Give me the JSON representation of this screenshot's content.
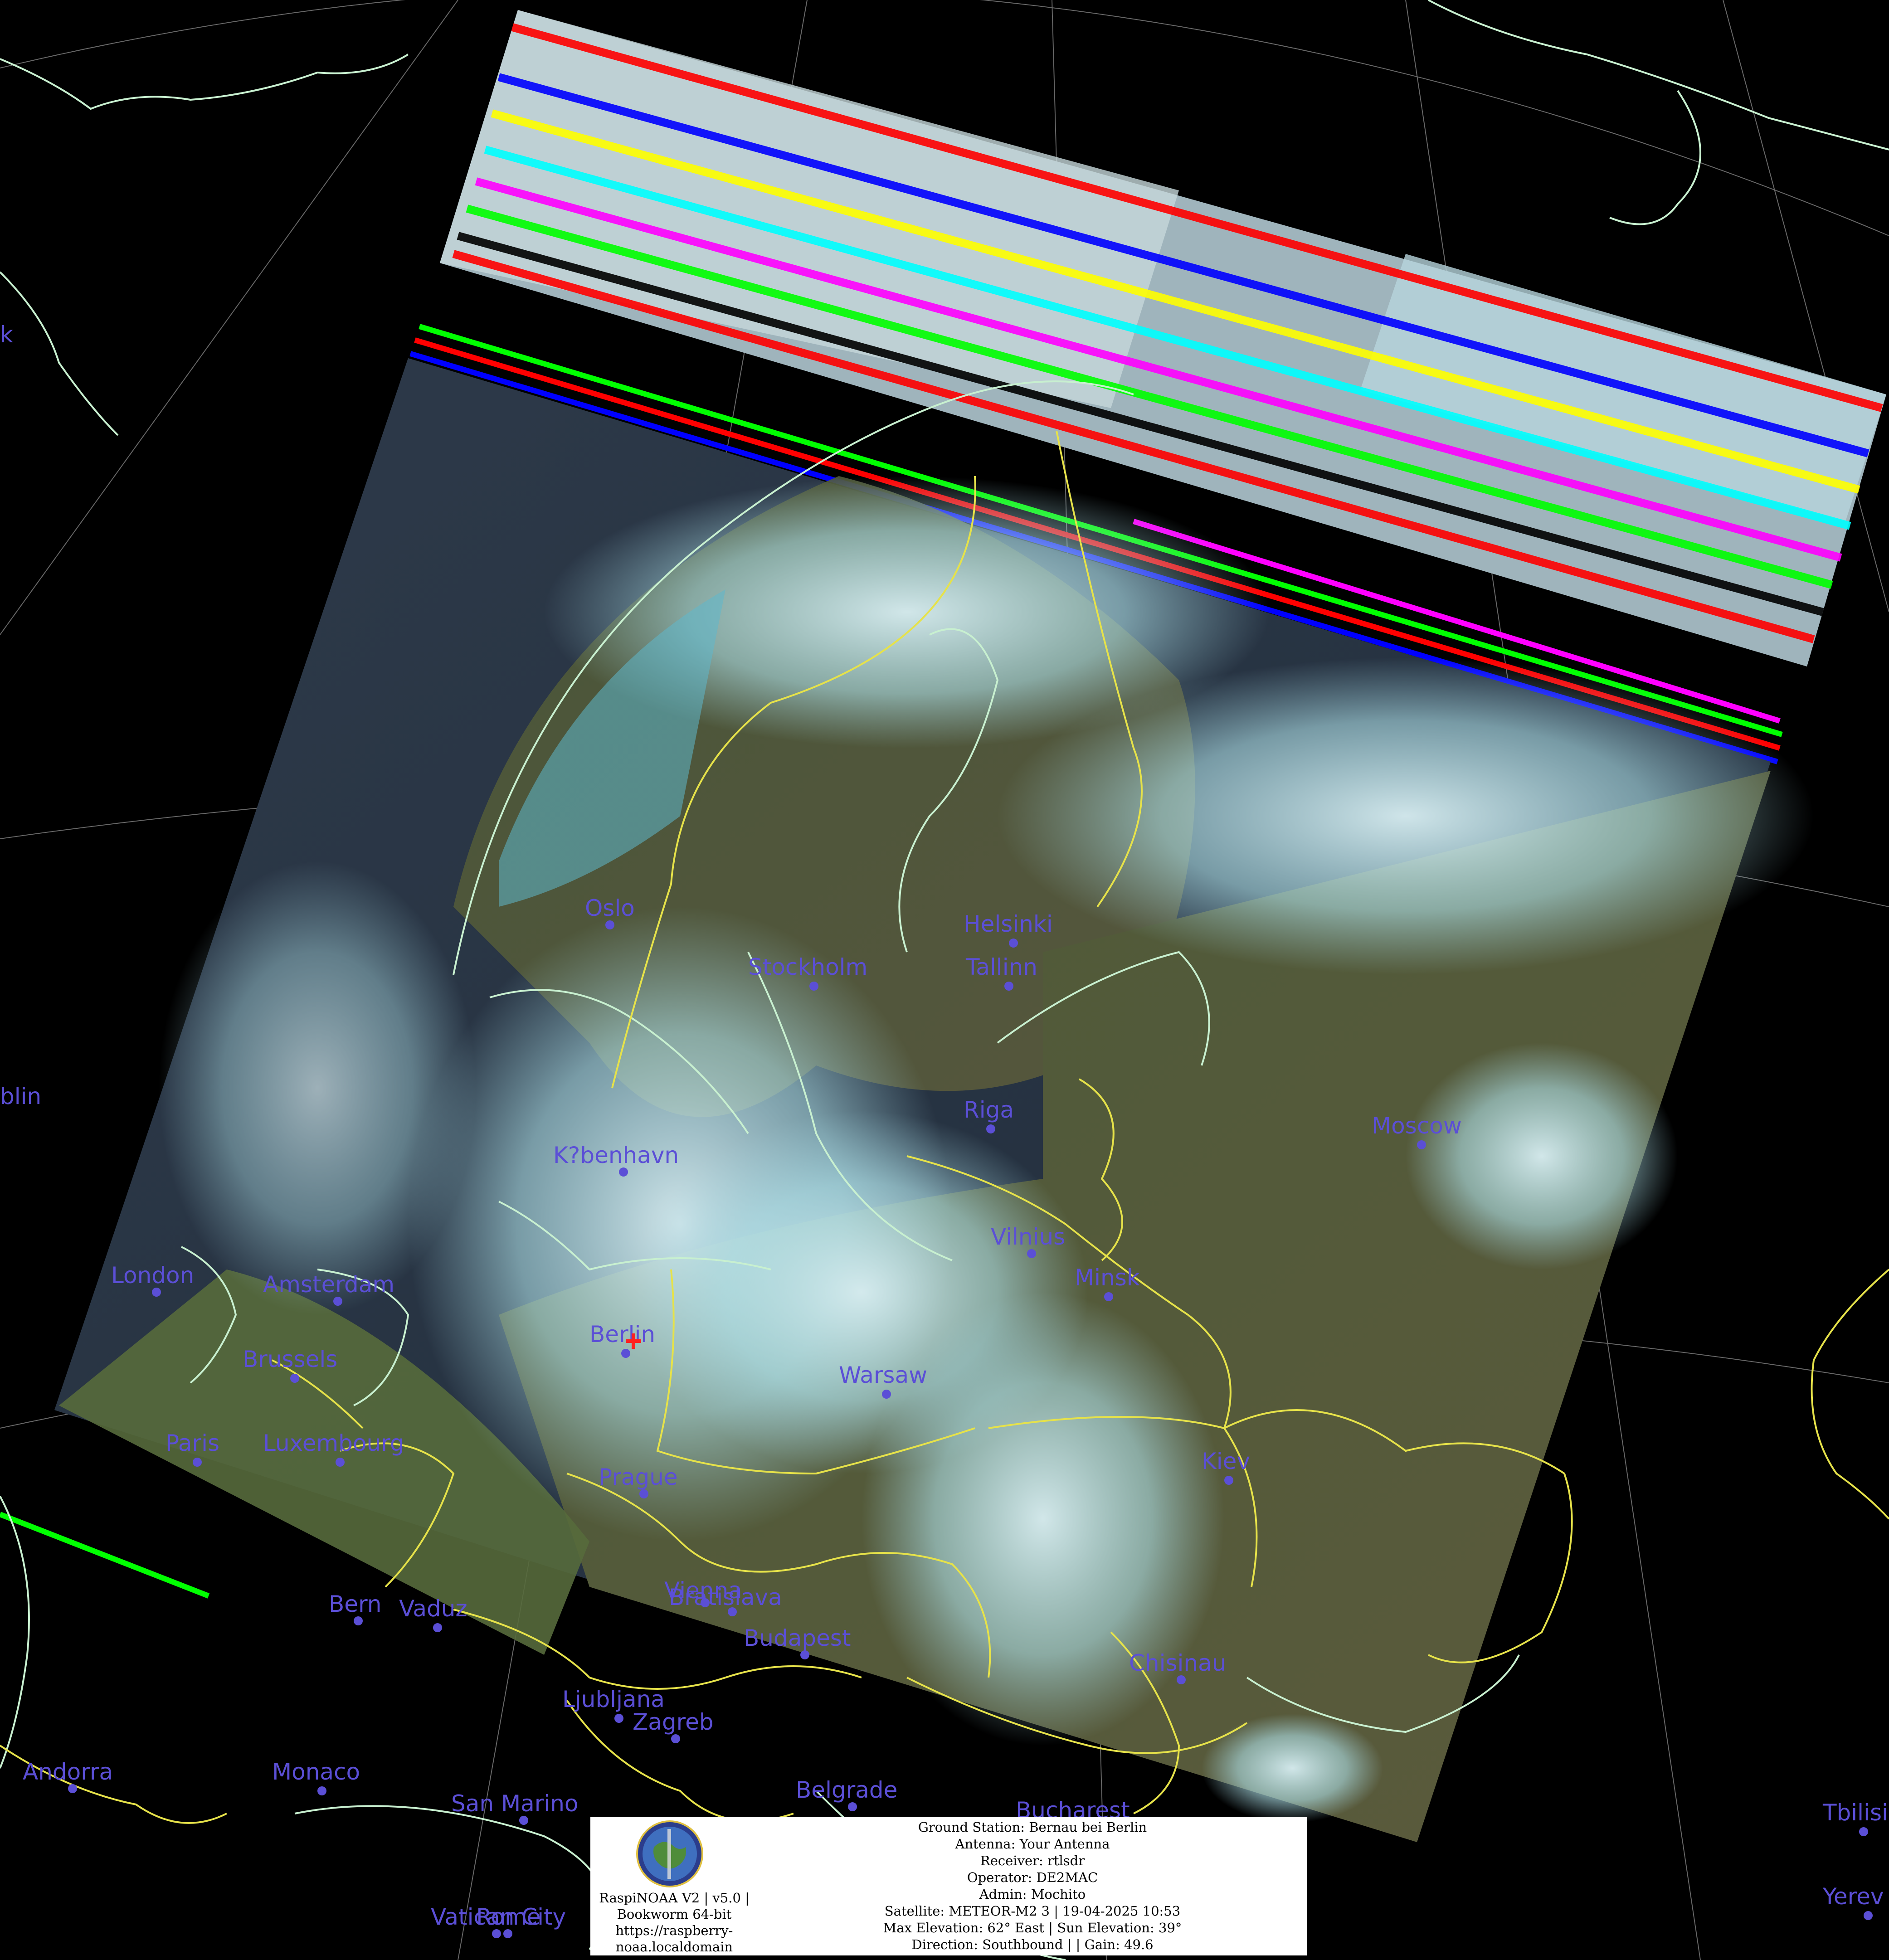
{
  "cities": [
    {
      "name": "Oslo",
      "id": "oslo"
    },
    {
      "name": "Stockholm",
      "id": "stockholm"
    },
    {
      "name": "Helsinki",
      "id": "helsinki"
    },
    {
      "name": "Tallinn",
      "id": "tallinn"
    },
    {
      "name": "Riga",
      "id": "riga"
    },
    {
      "name": "Moscow",
      "id": "moscow"
    },
    {
      "name": "K?benhavn",
      "id": "kobenhavn"
    },
    {
      "name": "Vilnius",
      "id": "vilnius"
    },
    {
      "name": "Minsk",
      "id": "minsk"
    },
    {
      "name": "London",
      "id": "london"
    },
    {
      "name": "Amsterdam",
      "id": "amsterdam"
    },
    {
      "name": "Brussels",
      "id": "brussels"
    },
    {
      "name": "Berlin",
      "id": "berlin"
    },
    {
      "name": "Warsaw",
      "id": "warsaw"
    },
    {
      "name": "Paris",
      "id": "paris"
    },
    {
      "name": "Luxembourg",
      "id": "luxembourg"
    },
    {
      "name": "Prague",
      "id": "prague"
    },
    {
      "name": "Kiev",
      "id": "kiev"
    },
    {
      "name": "Vienna",
      "id": "vienna"
    },
    {
      "name": "Bratislava",
      "id": "bratislava"
    },
    {
      "name": "Bern",
      "id": "bern"
    },
    {
      "name": "Vaduz",
      "id": "vaduz"
    },
    {
      "name": "Budapest",
      "id": "budapest"
    },
    {
      "name": "Chisinau",
      "id": "chisinau"
    },
    {
      "name": "Ljubljana",
      "id": "ljubljana"
    },
    {
      "name": "Zagreb",
      "id": "zagreb"
    },
    {
      "name": "Andorra",
      "id": "andorra"
    },
    {
      "name": "Monaco",
      "id": "monaco"
    },
    {
      "name": "San Marino",
      "id": "san-marino"
    },
    {
      "name": "Belgrade",
      "id": "belgrade"
    },
    {
      "name": "Bucharest",
      "id": "bucharest"
    },
    {
      "name": "Tbilisi",
      "id": "tbilisi"
    },
    {
      "name": "Yerev",
      "id": "yerevan"
    },
    {
      "name": "Vatican City",
      "id": "vatican-city"
    },
    {
      "name": "Rome",
      "id": "rome"
    },
    {
      "name": "blin",
      "id": "dublin"
    },
    {
      "name": "k",
      "id": "reykjavik"
    }
  ],
  "info": {
    "app_line1": "RaspiNOAA V2 | v5.0 |",
    "app_line2": "Bookworm 64-bit",
    "app_line3": "https://raspberry-",
    "app_line4": "noaa.localdomain",
    "ground_station": "Ground Station: Bernau bei Berlin",
    "antenna": "Antenna: Your Antenna",
    "receiver": "Receiver: rtlsdr",
    "operator": "Operator: DE2MAC",
    "admin": "Admin: Mochito",
    "satellite": "Satellite: METEOR-M2 3 | 19-04-2025 10:53",
    "elevation": "Max Elevation: 62° East | Sun Elevation: 39°",
    "direction": "Direction: Southbound | | Gain: 49.6"
  },
  "colors": {
    "city_label": "#5b4fd6",
    "coastline": "#c8f0d0",
    "border": "#e6e24a",
    "graticule": "#8a8a8a"
  }
}
